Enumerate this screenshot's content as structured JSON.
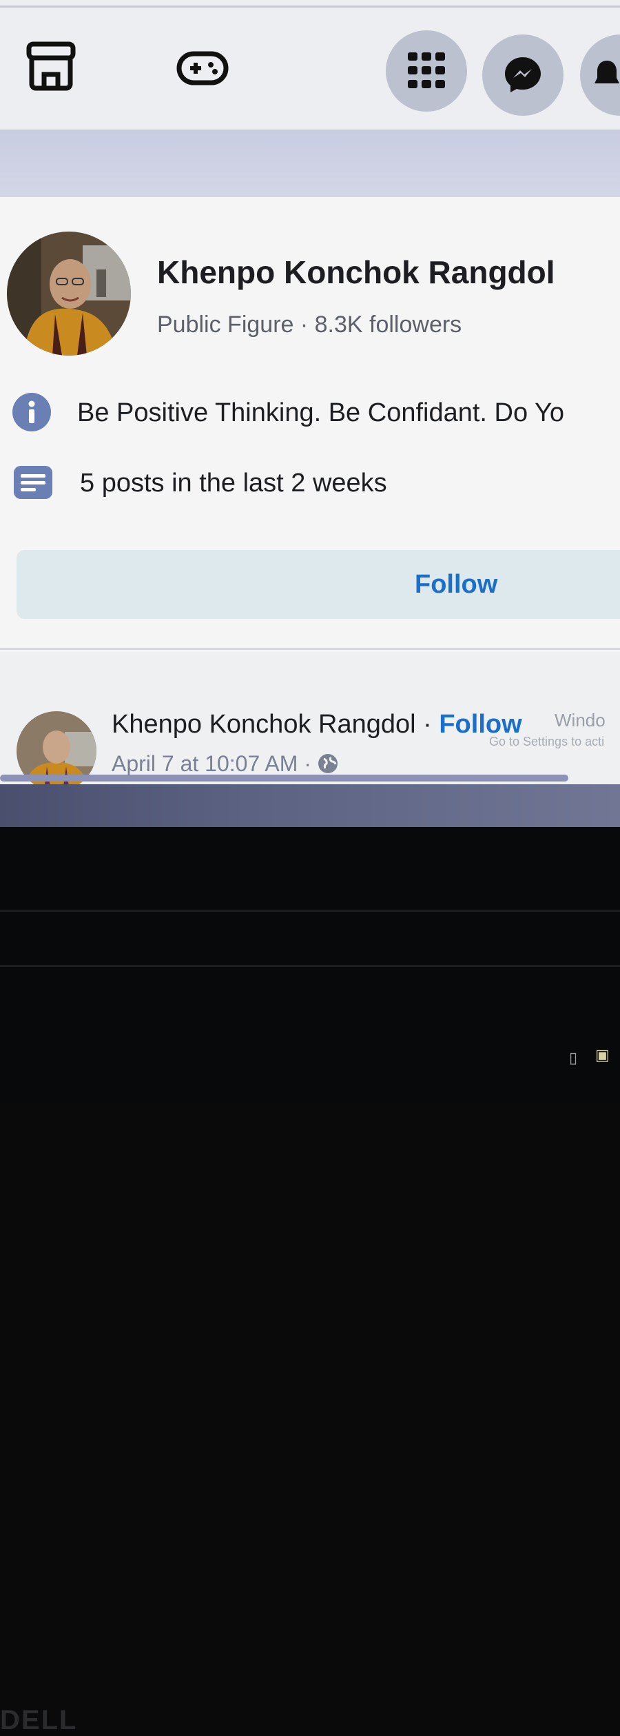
{
  "topbar": {
    "icons": [
      "marketplace-icon",
      "gaming-icon",
      "menu-grid-icon",
      "messenger-icon",
      "notifications-icon"
    ]
  },
  "profile": {
    "name": "Khenpo Konchok Rangdol",
    "meta": "Public Figure · 8.3K followers",
    "intro": "Be Positive Thinking. Be Confidant. Do Yo",
    "activity": "5 posts in the last 2 weeks",
    "follow_label": "Follow"
  },
  "post": {
    "author": "Khenpo Konchok Rangdol · ",
    "follow_label": "Follow",
    "date": "April 7 at 10:07 AM · ",
    "privacy_icon": "globe-icon"
  },
  "windows_watermark": {
    "line1": "Windo",
    "line2": "Go to Settings to acti"
  },
  "device": {
    "brand": "DELL"
  },
  "colors": {
    "accent": "#1b6fc9",
    "name": "#1c1e21",
    "meta": "#5c6068",
    "icon_blue": "#6a7fb3"
  }
}
